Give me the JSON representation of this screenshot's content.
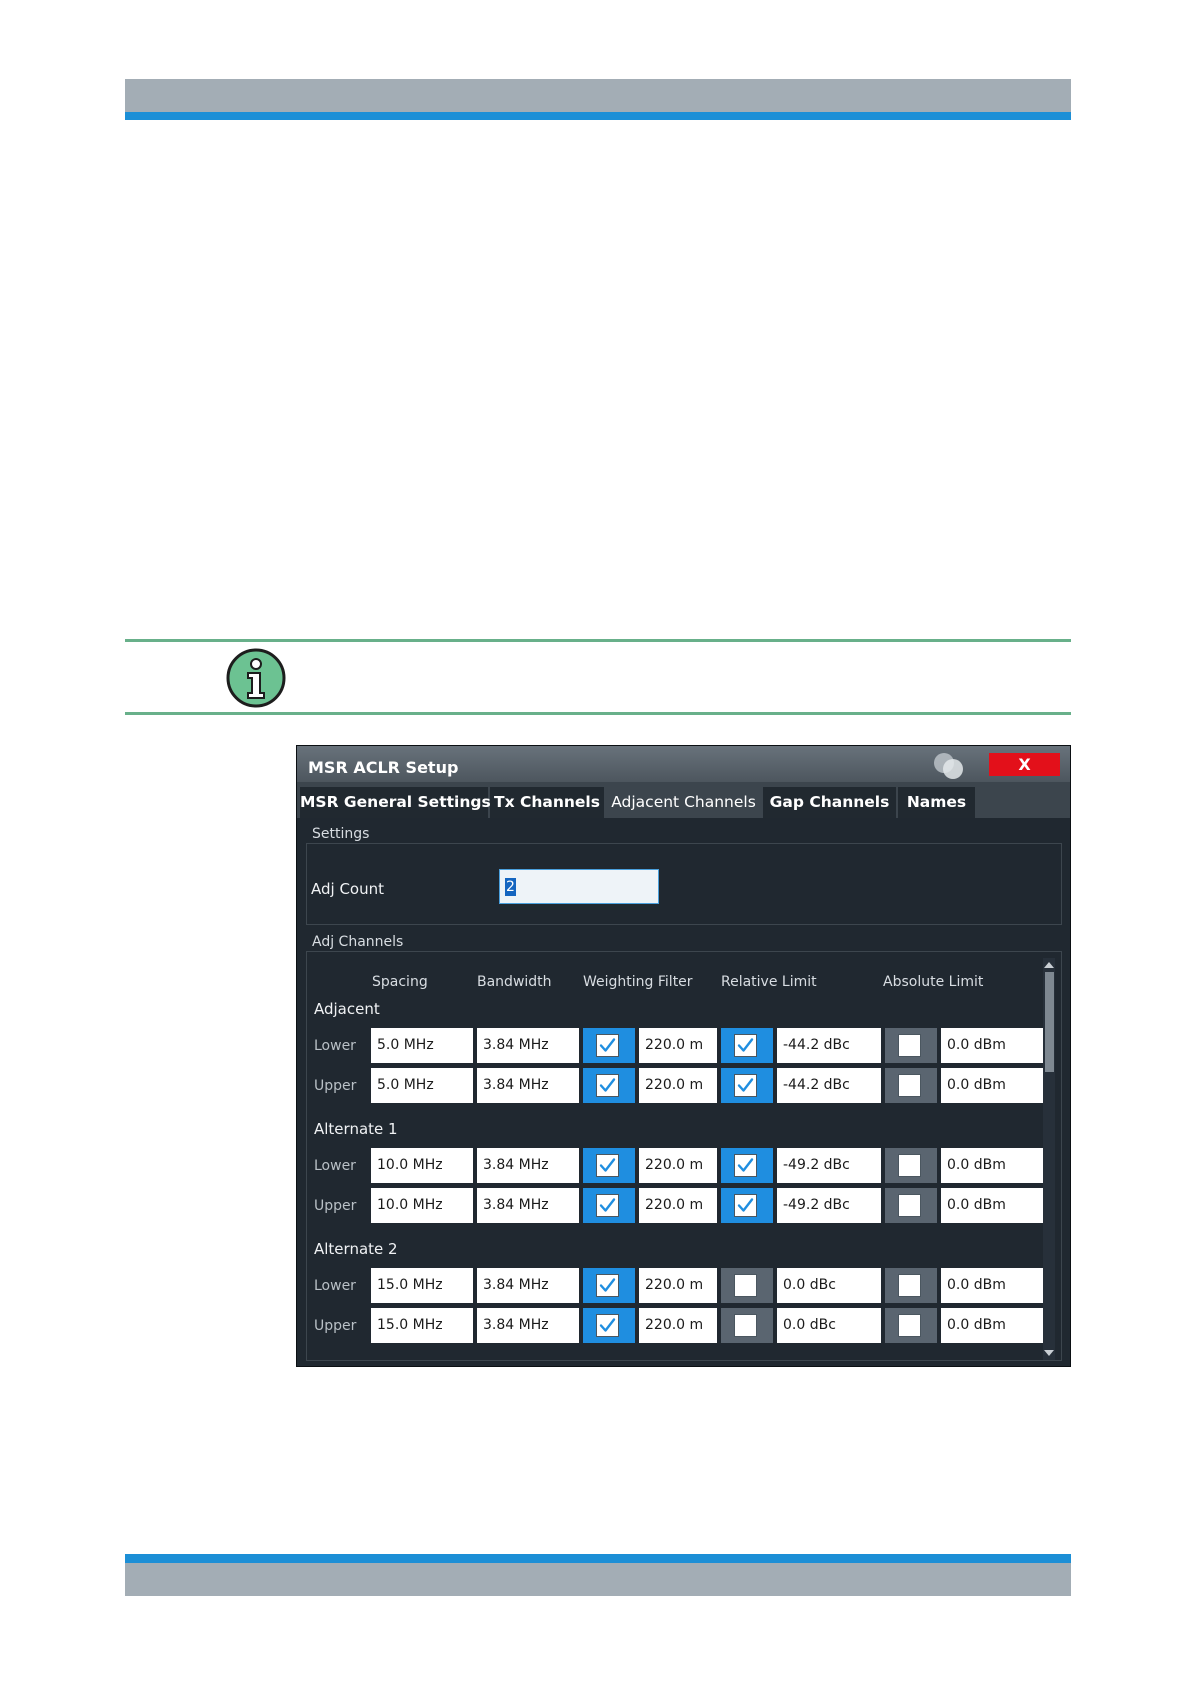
{
  "dialog": {
    "title": "MSR ACLR Setup",
    "close_label": "X",
    "tabs": [
      {
        "label": "MSR General Settings",
        "active": false
      },
      {
        "label": "Tx Channels",
        "active": false
      },
      {
        "label": "Adjacent Channels",
        "active": true
      },
      {
        "label": "Gap Channels",
        "active": false
      },
      {
        "label": "Names",
        "active": false
      }
    ],
    "settings": {
      "section_label": "Settings",
      "adj_count_label": "Adj Count",
      "adj_count_value": "2"
    },
    "adj_channels": {
      "section_label": "Adj Channels",
      "columns": [
        "Spacing",
        "Bandwidth",
        "Weighting Filter",
        "Relative Limit",
        "Absolute Limit"
      ],
      "groups": [
        {
          "label": "Adjacent",
          "rows": [
            {
              "label": "Lower",
              "spacing": "5.0 MHz",
              "bandwidth": "3.84 MHz",
              "weighting_on": true,
              "weighting": "220.0 m",
              "relative_on": true,
              "relative": "-44.2 dBc",
              "absolute_on": false,
              "absolute": "0.0 dBm"
            },
            {
              "label": "Upper",
              "spacing": "5.0 MHz",
              "bandwidth": "3.84 MHz",
              "weighting_on": true,
              "weighting": "220.0 m",
              "relative_on": true,
              "relative": "-44.2 dBc",
              "absolute_on": false,
              "absolute": "0.0 dBm"
            }
          ]
        },
        {
          "label": "Alternate 1",
          "rows": [
            {
              "label": "Lower",
              "spacing": "10.0 MHz",
              "bandwidth": "3.84 MHz",
              "weighting_on": true,
              "weighting": "220.0 m",
              "relative_on": true,
              "relative": "-49.2 dBc",
              "absolute_on": false,
              "absolute": "0.0 dBm"
            },
            {
              "label": "Upper",
              "spacing": "10.0 MHz",
              "bandwidth": "3.84 MHz",
              "weighting_on": true,
              "weighting": "220.0 m",
              "relative_on": true,
              "relative": "-49.2 dBc",
              "absolute_on": false,
              "absolute": "0.0 dBm"
            }
          ]
        },
        {
          "label": "Alternate 2",
          "rows": [
            {
              "label": "Lower",
              "spacing": "15.0 MHz",
              "bandwidth": "3.84 MHz",
              "weighting_on": true,
              "weighting": "220.0 m",
              "relative_on": false,
              "relative": "0.0 dBc",
              "absolute_on": false,
              "absolute": "0.0 dBm"
            },
            {
              "label": "Upper",
              "spacing": "15.0 MHz",
              "bandwidth": "3.84 MHz",
              "weighting_on": true,
              "weighting": "220.0 m",
              "relative_on": false,
              "relative": "0.0 dBc",
              "absolute_on": false,
              "absolute": "0.0 dBm"
            }
          ]
        }
      ]
    }
  },
  "icons": {
    "info": "info-icon",
    "window_state": "window-circles-icon",
    "checkbox": "checkmark-icon",
    "scroll_up": "scroll-up-arrow-icon",
    "scroll_down": "scroll-down-arrow-icon"
  },
  "colors": {
    "header_grey": "#a3adb5",
    "header_blue": "#1c8fd6",
    "note_green": "#68b08a",
    "dialog_bg": "#202830",
    "checked_blue": "#1f8ee0",
    "close_red": "#e3101a"
  }
}
